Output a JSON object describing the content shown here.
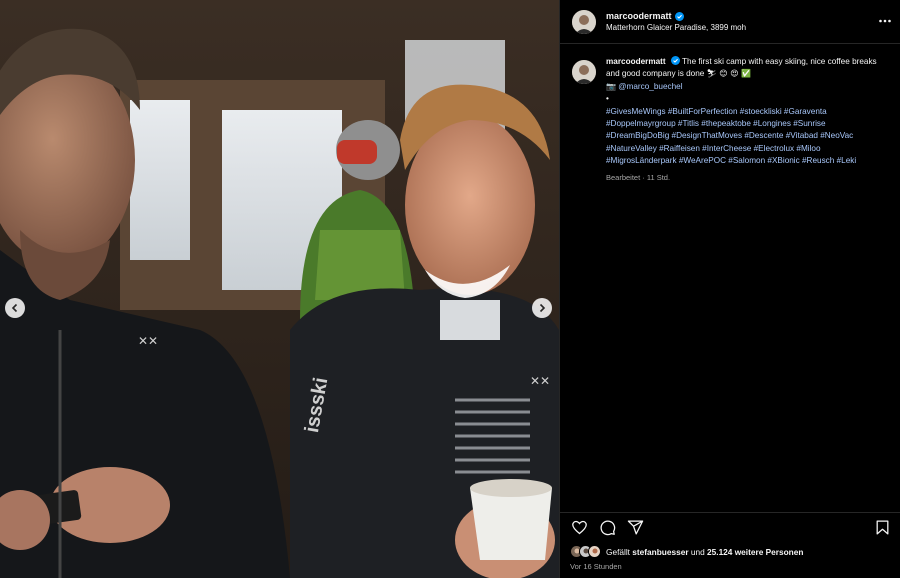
{
  "post": {
    "author": {
      "username": "marcoodermatt",
      "location": "Matterhorn Glaicer Paradise, 3899 moh"
    },
    "caption": {
      "text": "The first ski camp with easy skiing, nice coffee breaks and good company is done",
      "emojis": "⛷ 😊 😍 ✅",
      "camera_emoji": "📷",
      "mention": "@marco_buechel",
      "bullet": "•",
      "hashtag_lines": [
        "#GivesMeWings #BuiltForPerfection #stoeckliski #Garaventa",
        "#Doppelmayrgroup #Titlis #thepeaktobe #Longines #Sunrise",
        "#DreamBigDoBig #DesignThatMoves #Descente #Vitabad #NeoVac",
        "#NatureValley #Raiffeisen #InterCheese #Electrolux #Miloo",
        "#MigrosLänderpark #WeArePOC #Salomon #XBionic #Reusch #Leki"
      ],
      "edited": "Bearbeitet · 11 Std."
    },
    "likes": {
      "prefix": "Gefällt",
      "first_liker": "stefanbuesser",
      "middle": "und",
      "others": "25.124 weitere Personen"
    },
    "timestamp": "Vor 16 Stunden"
  },
  "icons": {
    "verified": "verified-badge-icon",
    "more": "more-options-icon",
    "like": "heart-icon",
    "comment": "comment-icon",
    "share": "share-icon",
    "save": "bookmark-icon",
    "prev": "chevron-left-icon",
    "next": "chevron-right-icon"
  },
  "colors": {
    "background": "#000000",
    "text": "#f5f5f5",
    "link": "#a8c7fa",
    "verified": "#0095f6",
    "muted": "#a8a8a8"
  }
}
